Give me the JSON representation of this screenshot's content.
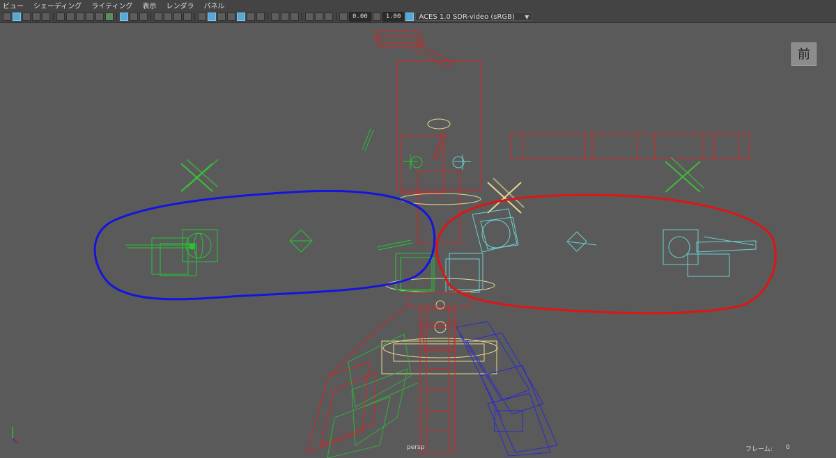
{
  "menu": [
    "ビュー",
    "シェーディング",
    "ライティング",
    "表示",
    "レンダラ",
    "パネル"
  ],
  "toolbar": {
    "exposure": "0.00",
    "gamma": "1.00",
    "color_space": "ACES 1.0 SDR-video (sRGB)"
  },
  "view_cube_label": "前",
  "hud": {
    "camera": "persp",
    "frame_label": "フレーム:",
    "frame_value": "0"
  },
  "colors": {
    "viewport_bg": "#5a5a5a",
    "blue_selection": "#1414e0",
    "red_selection": "#e01414",
    "rig_green": "#22c832",
    "rig_red": "#e02020",
    "rig_blue": "#2a2ad0",
    "rig_cyan": "#6ad0d0",
    "rig_yellow": "#e8d890"
  }
}
